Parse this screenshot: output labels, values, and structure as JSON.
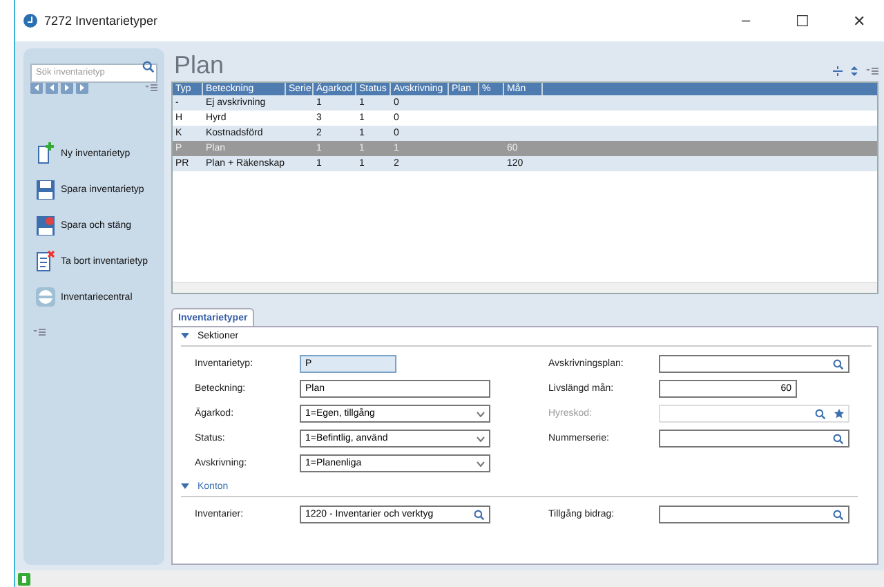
{
  "window": {
    "title": "7272 Inventarietyper",
    "controls": [
      "–",
      "☐",
      "✕"
    ]
  },
  "sidebar": {
    "search": {
      "placeholder": "Sök inventarietyp"
    },
    "actions": [
      {
        "label": "Ny inventarietyp",
        "kind": "new"
      },
      {
        "label": "Spara inventarietyp",
        "kind": "save"
      },
      {
        "label": "Spara och stäng",
        "kind": "saveclose"
      },
      {
        "label": "Ta bort inventarietyp",
        "kind": "delete"
      },
      {
        "label": "Inventariecentral",
        "kind": "central"
      }
    ]
  },
  "heading": "Plan",
  "table": {
    "columns": [
      "Typ",
      "Beteckning",
      "Serie",
      "Ägarkod",
      "Status",
      "Avskrivning",
      "Plan",
      "%",
      "Mån"
    ],
    "rows": [
      {
        "cells": [
          "-",
          "Ej avskrivning",
          "",
          "1",
          "1",
          "0",
          "",
          "",
          ""
        ],
        "selected": false
      },
      {
        "cells": [
          "H",
          "Hyrd",
          "",
          "3",
          "1",
          "0",
          "",
          "",
          ""
        ],
        "selected": false
      },
      {
        "cells": [
          "K",
          "Kostnadsförd",
          "",
          "2",
          "1",
          "0",
          "",
          "",
          ""
        ],
        "selected": false
      },
      {
        "cells": [
          "P",
          "Plan",
          "",
          "1",
          "1",
          "1",
          "",
          "",
          "60"
        ],
        "selected": true
      },
      {
        "cells": [
          "PR",
          "Plan + Räkenskap",
          "",
          "1",
          "1",
          "2",
          "",
          "",
          "120"
        ],
        "selected": false
      }
    ]
  },
  "tabs": [
    {
      "label": "Inventarietyper",
      "selected": true
    }
  ],
  "sections": [
    {
      "title": "Sektioner",
      "expanded": true,
      "left": [
        {
          "label": "Inventarietyp:",
          "value": "P",
          "kind": "key",
          "disabled": false
        },
        {
          "label": "Beteckning:",
          "value": "Plan",
          "kind": "text",
          "disabled": false
        },
        {
          "label": "Ägarkod:",
          "value": "1=Egen, tillgång",
          "kind": "select",
          "disabled": false
        },
        {
          "label": "Status:",
          "value": "1=Befintlig, använd",
          "kind": "select",
          "disabled": false
        },
        {
          "label": "Avskrivning:",
          "value": "1=Planenliga",
          "kind": "select",
          "disabled": false
        }
      ],
      "right": [
        {
          "label": "Avskrivningsplan:",
          "kind": "lookup",
          "disabled": false
        },
        {
          "label": "Livslängd mån:",
          "value": "60",
          "kind": "number",
          "disabled": false
        },
        {
          "label": "Hyreskod:",
          "kind": "lookupstar",
          "disabled": true
        },
        {
          "label": "Nummerserie:",
          "kind": "lookup",
          "disabled": false
        }
      ]
    },
    {
      "title": "Konton",
      "expanded": true,
      "left": [
        {
          "label": "Inventarier:",
          "value": "1220 - Inventarier och verktyg",
          "kind": "lookup",
          "disabled": false
        }
      ],
      "right": [
        {
          "label": "Tillgång bidrag:",
          "kind": "lookup",
          "disabled": false
        }
      ]
    }
  ]
}
